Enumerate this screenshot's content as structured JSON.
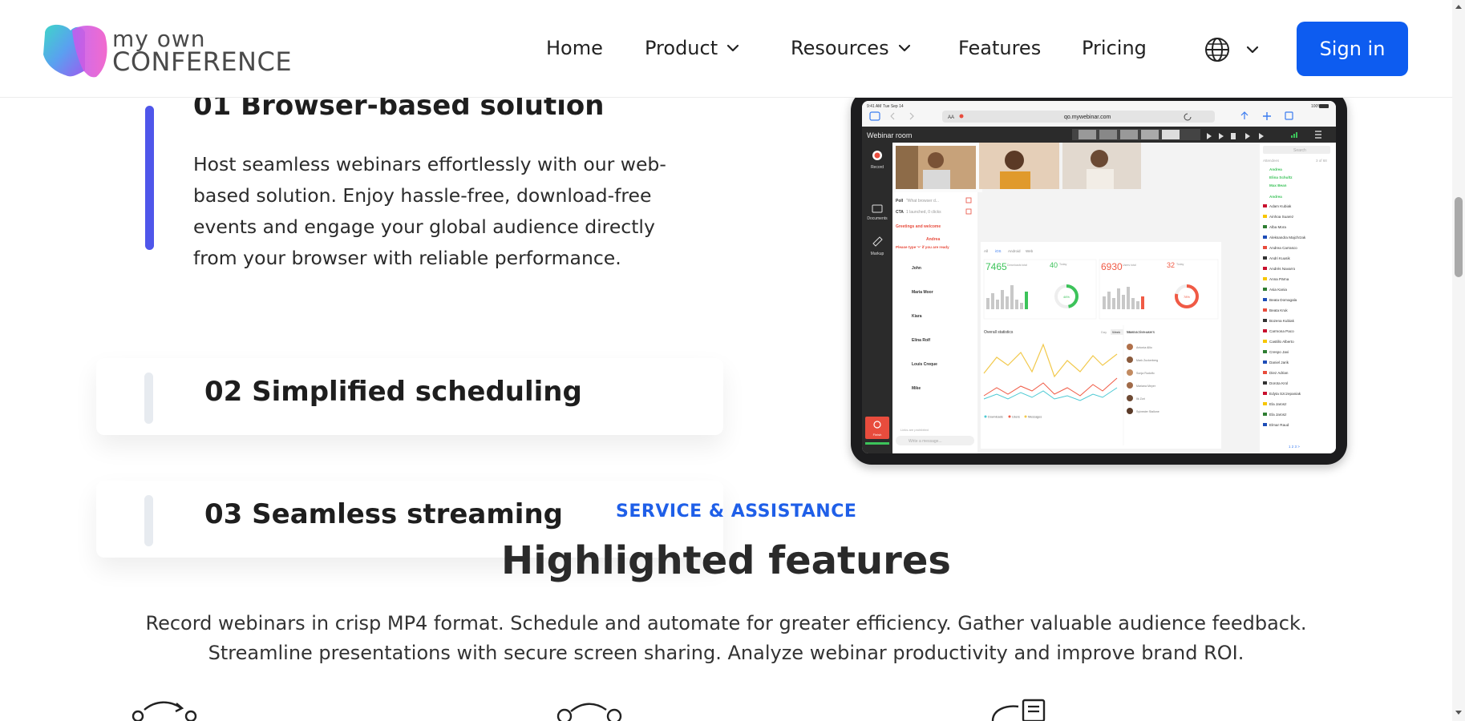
{
  "header": {
    "logo_line1": "my own",
    "logo_line2": "CONFERENCE",
    "nav": [
      "Home",
      "Product",
      "Resources",
      "Features",
      "Pricing"
    ],
    "signin_label": "Sign in"
  },
  "steps": [
    {
      "title": "01 Browser-based solution",
      "description": "Host seamless webinars effortlessly with our web-based solution. Enjoy hassle-free, download-free events and engage your global audience directly from your browser with reliable performance.",
      "active": true
    },
    {
      "title": "02 Simplified scheduling",
      "active": false
    },
    {
      "title": "03 Seamless streaming",
      "active": false
    }
  ],
  "mockup": {
    "status_time": "9:41 AM",
    "status_date": "Tue Sep 14",
    "battery": "100%",
    "url": "qo.mywebinar.com",
    "aa": "AA",
    "room_title": "Webinar room",
    "sidebar": [
      "Record",
      "Documents",
      "Markup"
    ],
    "finish_label": "Finish",
    "chat": {
      "poll_label": "Poll",
      "poll_text": "\"What browser d...",
      "cta_label": "CTA",
      "cta_text": "1 launched, 0 clicks",
      "greeting": "Greetings and welcome",
      "andrea": "Andrea",
      "andrea_msg": "Please type '+' if you are ready",
      "users": [
        "John",
        "Maria Moor",
        "Kiara",
        "Elina Rolf",
        "Louis Creque",
        "Mike"
      ],
      "footer": "Links are prohibited",
      "input_placeholder": "Write a message..."
    },
    "stats": {
      "tabs": [
        "All",
        "iOS",
        "Android",
        "Web"
      ],
      "val1": "7465",
      "val1_label": "Downloads total",
      "today1": "40",
      "today_label": "Today",
      "pct1": "46%",
      "val2": "6930",
      "val2_label": "Users total",
      "today2": "32",
      "pct2": "78%",
      "overall": "Overall statistics",
      "periods": [
        "Day",
        "Week",
        "Month",
        "Year"
      ],
      "legend": [
        "Downloads",
        "Users",
        "Messages"
      ],
      "most_active": "Most active users",
      "active_users": [
        "Antonia Allio",
        "Mark Zuckerberg",
        "Sonja Rudolfo",
        "Mariana Meyer",
        "Ilk Zori",
        "Sylvester Stallone"
      ]
    },
    "attendees": {
      "search": "Search",
      "label": "Attendees",
      "count": "3 of 68",
      "highlight": [
        "Andrea",
        "Elina Schultz",
        "Max Bean"
      ],
      "host": "Andrea",
      "list": [
        "Adam Kubiak",
        "Ainhoa Suarez",
        "Alba Mora",
        "Aleksandra Majchrzak",
        "Andrea Carrasco",
        "Andri Kuusik",
        "Andrés Navarro",
        "Anna Pärna",
        "Asia Kania",
        "Beata Domagala",
        "Beata Kruk",
        "Bozena Kubiak",
        "Carmona Paco",
        "Castillo Alberto",
        "Crespo Javi",
        "Daniel Jarik",
        "Diez Adrian",
        "Dorota Krol",
        "Edyta Szczepaniak",
        "Ela Jarosz",
        "Ela Jarosz",
        "Elmar Raud"
      ],
      "pager": "1 2 3 >"
    }
  },
  "section": {
    "eyebrow": "SERVICE & ASSISTANCE",
    "title": "Highlighted features",
    "desc_line1": "Record webinars in crisp MP4 format. Schedule and automate for greater efficiency. Gather valuable audience feedback.",
    "desc_line2": "Streamline presentations with secure screen sharing. Analyze webinar productivity and improve brand ROI."
  },
  "colors": {
    "brand_blue": "#0d5cf0",
    "eyebrow_blue": "#1f5fe8",
    "active_bar": "#4f56ea",
    "inactive_bar": "#e7ebf0",
    "green": "#3cc35a",
    "red": "#f05a45"
  }
}
